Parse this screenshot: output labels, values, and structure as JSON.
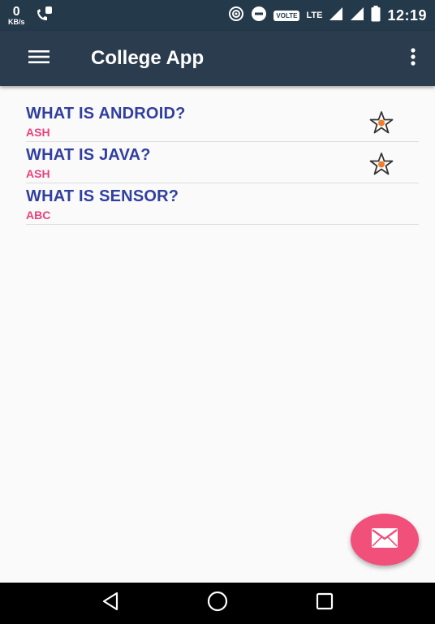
{
  "status_bar": {
    "speed_value": "0",
    "speed_unit": "KB/s",
    "volte": "VOLTE",
    "lte": "LTE",
    "time": "12:19"
  },
  "app_bar": {
    "title": "College App",
    "menu_icon": "hamburger-menu-icon",
    "more_icon": "more-vert-icon"
  },
  "questions": [
    {
      "title": "WHAT IS ANDROID?",
      "author": "ASH",
      "starred": true
    },
    {
      "title": "WHAT IS JAVA?",
      "author": "ASH",
      "starred": true
    },
    {
      "title": "WHAT IS SENSOR?",
      "author": "ABC",
      "starred": false
    }
  ],
  "fab": {
    "icon": "mail-icon"
  },
  "colors": {
    "app_bar": "#2b3c4f",
    "status_bar": "#24394a",
    "title_text": "#303f9f",
    "author_text": "#ec407a",
    "fab": "#f0507a"
  }
}
